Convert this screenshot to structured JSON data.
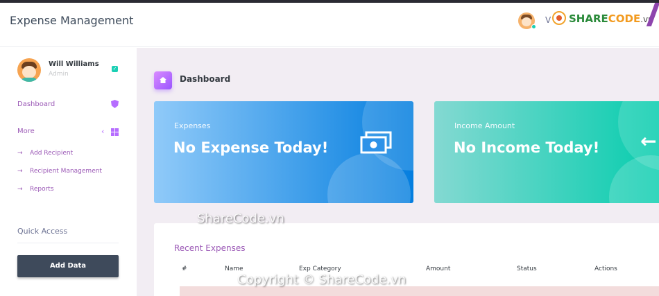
{
  "app": {
    "title": "Expense Management"
  },
  "navbar": {
    "user_initial": "V",
    "logo": {
      "part1": "SHARE",
      "part2": "CODE",
      "suffix": ".vn"
    }
  },
  "sidebar": {
    "profile": {
      "name": "Will Williams",
      "role": "Admin"
    },
    "dashboard_label": "Dashboard",
    "more_label": "More",
    "sub_items": [
      {
        "label": "Add Recipient"
      },
      {
        "label": "Recipient Management"
      },
      {
        "label": "Reports"
      }
    ],
    "quick_access_label": "Quick Access",
    "add_data_label": "Add Data"
  },
  "main": {
    "page_title": "Dashboard",
    "cards": [
      {
        "label": "Expenses",
        "value": "No Expense Today!",
        "icon": "money-icon",
        "color_from": "#90caf9",
        "color_to": "#047edf"
      },
      {
        "label": "Income Amount",
        "value": "No Income Today!",
        "icon": "arrow-left-icon",
        "color_from": "#84d9d2",
        "color_to": "#07cdae"
      }
    ],
    "recent": {
      "title": "Recent Expenses",
      "columns": [
        "#",
        "Name",
        "Exp Category",
        "Amount",
        "Status",
        "Actions"
      ]
    }
  },
  "watermarks": [
    "ShareCode.vn",
    "Copyright © ShareCode.vn"
  ],
  "colors": {
    "accent": "#b66dff",
    "sidebar_link": "#9b59b6",
    "button": "#3e4a5b"
  }
}
